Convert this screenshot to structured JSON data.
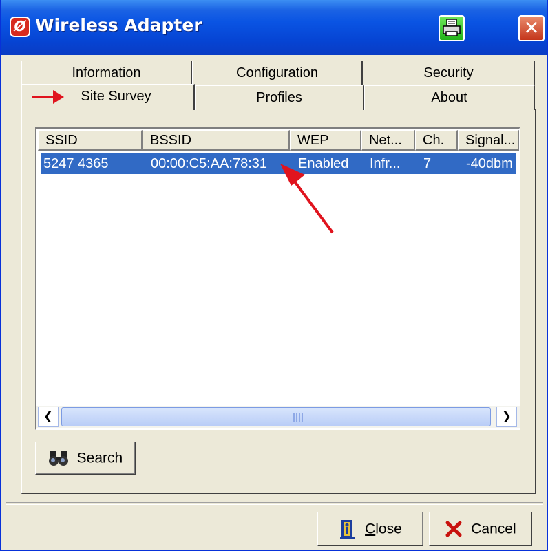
{
  "window": {
    "title": "Wireless Adapter",
    "app_icon_glyph": "Ø",
    "close_glyph": "✕"
  },
  "tabs": {
    "row1": [
      {
        "label": "Information"
      },
      {
        "label": "Configuration"
      },
      {
        "label": "Security"
      }
    ],
    "row2": [
      {
        "label": "Site Survey",
        "active": true
      },
      {
        "label": "Profiles"
      },
      {
        "label": "About"
      }
    ]
  },
  "list": {
    "columns": [
      "SSID",
      "BSSID",
      "WEP",
      "Net...",
      "Ch.",
      "Signal..."
    ],
    "rows": [
      {
        "ssid": "5247 4365",
        "bssid": "00:00:C5:AA:78:31",
        "wep": "Enabled",
        "net": "Infr...",
        "ch": "7",
        "signal": "-40dbm",
        "selected": true
      }
    ]
  },
  "scrollbar": {
    "left_glyph": "❮",
    "right_glyph": "❯"
  },
  "buttons": {
    "search_label": "Search",
    "close_mnemonic": "C",
    "close_rest": "lose",
    "cancel_label": "Cancel"
  },
  "colors": {
    "title_bar": "#0a54e3",
    "selection": "#316ac5",
    "annotation_arrow": "#e0141e",
    "face": "#ece9d8"
  },
  "icons": [
    "app-logo-icon",
    "printer-icon",
    "close-icon",
    "binoculars-icon",
    "door-exit-icon",
    "red-x-icon",
    "arrow-pointer-icon"
  ]
}
